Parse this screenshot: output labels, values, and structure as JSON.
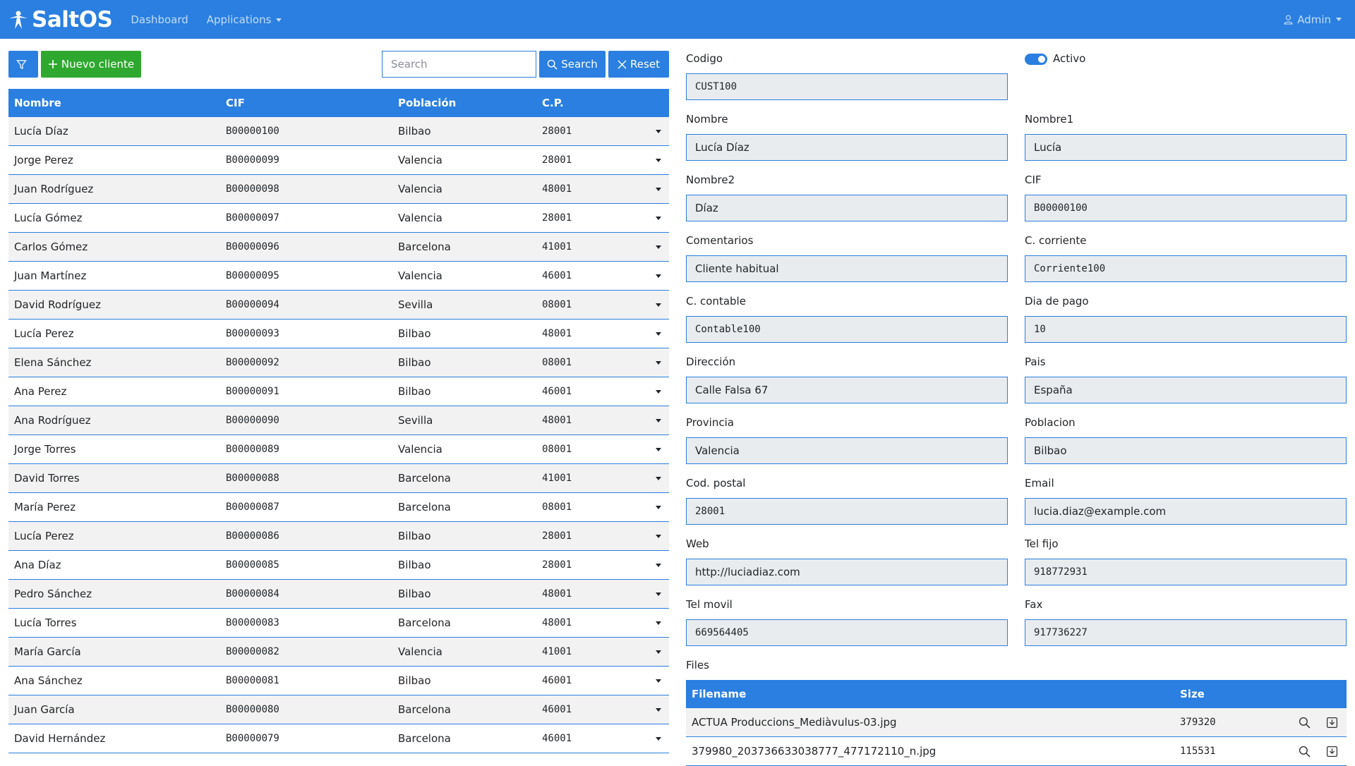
{
  "navbar": {
    "brand": "SaltOS",
    "links": [
      "Dashboard",
      "Applications"
    ],
    "user": "Admin"
  },
  "toolbar": {
    "new_label": "Nuevo cliente",
    "search_placeholder": "Search",
    "search_label": "Search",
    "reset_label": "Reset"
  },
  "table": {
    "headers": [
      "Nombre",
      "CIF",
      "Población",
      "C.P."
    ],
    "rows": [
      [
        "Lucía Díaz",
        "B00000100",
        "Bilbao",
        "28001"
      ],
      [
        "Jorge Perez",
        "B00000099",
        "Valencia",
        "28001"
      ],
      [
        "Juan Rodríguez",
        "B00000098",
        "Valencia",
        "48001"
      ],
      [
        "Lucía Gómez",
        "B00000097",
        "Valencia",
        "28001"
      ],
      [
        "Carlos Gómez",
        "B00000096",
        "Barcelona",
        "41001"
      ],
      [
        "Juan Martínez",
        "B00000095",
        "Valencia",
        "46001"
      ],
      [
        "David Rodríguez",
        "B00000094",
        "Sevilla",
        "08001"
      ],
      [
        "Lucía Perez",
        "B00000093",
        "Bilbao",
        "48001"
      ],
      [
        "Elena Sánchez",
        "B00000092",
        "Bilbao",
        "08001"
      ],
      [
        "Ana Perez",
        "B00000091",
        "Bilbao",
        "46001"
      ],
      [
        "Ana Rodríguez",
        "B00000090",
        "Sevilla",
        "48001"
      ],
      [
        "Jorge Torres",
        "B00000089",
        "Valencia",
        "08001"
      ],
      [
        "David Torres",
        "B00000088",
        "Barcelona",
        "41001"
      ],
      [
        "María Perez",
        "B00000087",
        "Barcelona",
        "08001"
      ],
      [
        "Lucía Perez",
        "B00000086",
        "Bilbao",
        "28001"
      ],
      [
        "Ana Díaz",
        "B00000085",
        "Bilbao",
        "28001"
      ],
      [
        "Pedro Sánchez",
        "B00000084",
        "Bilbao",
        "48001"
      ],
      [
        "Lucía Torres",
        "B00000083",
        "Barcelona",
        "48001"
      ],
      [
        "María García",
        "B00000082",
        "Valencia",
        "41001"
      ],
      [
        "Ana Sánchez",
        "B00000081",
        "Bilbao",
        "46001"
      ],
      [
        "Juan García",
        "B00000080",
        "Barcelona",
        "46001"
      ],
      [
        "David Hernández",
        "B00000079",
        "Barcelona",
        "46001"
      ]
    ]
  },
  "form": {
    "activo_label": "Activo",
    "fields": {
      "codigo": {
        "label": "Codigo",
        "value": "CUST100"
      },
      "nombre": {
        "label": "Nombre",
        "value": "Lucía Díaz"
      },
      "nombre1": {
        "label": "Nombre1",
        "value": "Lucía"
      },
      "nombre2": {
        "label": "Nombre2",
        "value": "Díaz"
      },
      "cif": {
        "label": "CIF",
        "value": "B00000100"
      },
      "comentarios": {
        "label": "Comentarios",
        "value": "Cliente habitual"
      },
      "c_corriente": {
        "label": "C. corriente",
        "value": "Corriente100"
      },
      "c_contable": {
        "label": "C. contable",
        "value": "Contable100"
      },
      "dia_pago": {
        "label": "Dia de pago",
        "value": "10"
      },
      "direccion": {
        "label": "Dirección",
        "value": "Calle Falsa 67"
      },
      "pais": {
        "label": "Pais",
        "value": "España"
      },
      "provincia": {
        "label": "Provincia",
        "value": "Valencia"
      },
      "poblacion": {
        "label": "Poblacion",
        "value": "Bilbao"
      },
      "cod_postal": {
        "label": "Cod. postal",
        "value": "28001"
      },
      "email": {
        "label": "Email",
        "value": "lucia.diaz@example.com"
      },
      "web": {
        "label": "Web",
        "value": "http://luciadiaz.com"
      },
      "tel_fijo": {
        "label": "Tel fijo",
        "value": "918772931"
      },
      "tel_movil": {
        "label": "Tel movil",
        "value": "669564405"
      },
      "fax": {
        "label": "Fax",
        "value": "917736227"
      }
    },
    "files_label": "Files"
  },
  "files": {
    "headers": [
      "Filename",
      "Size"
    ],
    "rows": [
      [
        "ACTUA Produccions_Mediàvulus-03.jpg",
        "379320"
      ],
      [
        "379980_203736633038777_477172110_n.jpg",
        "115531"
      ]
    ]
  },
  "colors": {
    "primary": "#2a7fe0",
    "success": "#2fa82f",
    "input_bg": "#e9ecef",
    "row_alt": "#f2f2f2"
  },
  "icons": [
    "saltos-logo-icon",
    "person-icon",
    "filter-icon",
    "plus-icon",
    "search-icon",
    "x-icon",
    "chevron-down-icon",
    "magnifier-icon",
    "download-icon"
  ]
}
